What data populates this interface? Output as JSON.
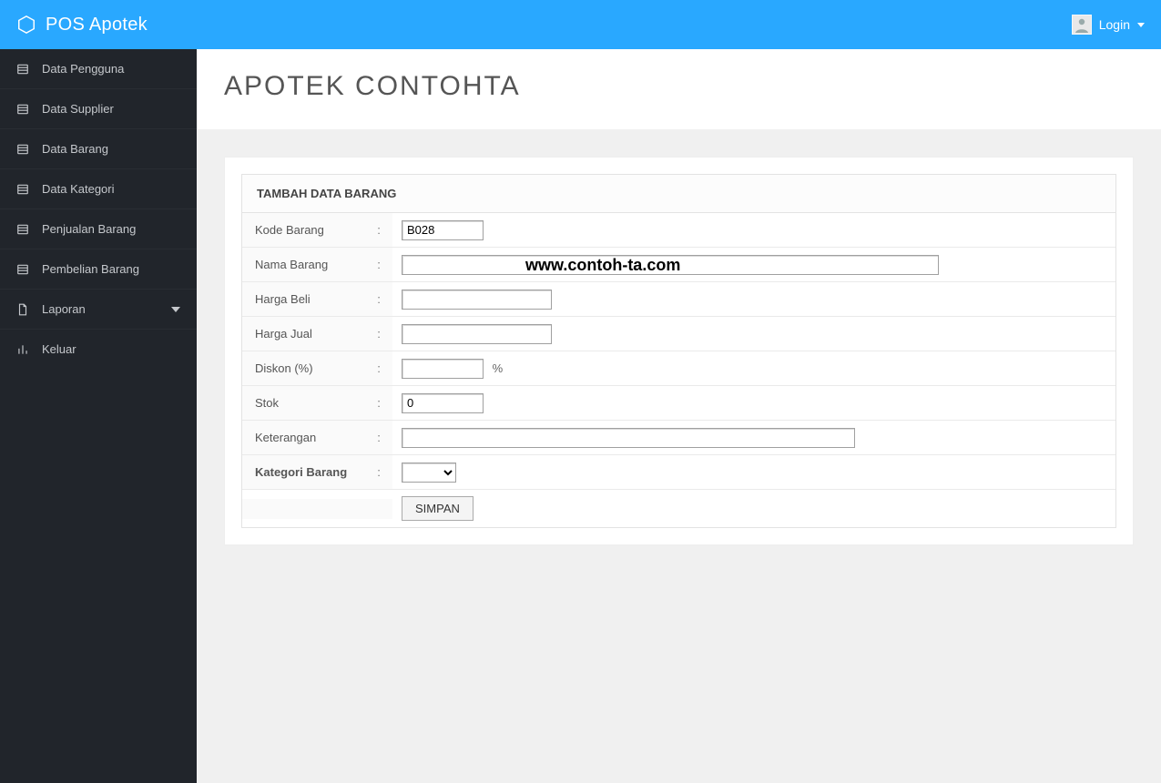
{
  "topbar": {
    "brand": "POS Apotek",
    "login_label": "Login"
  },
  "sidebar": {
    "items": [
      {
        "label": "Data Pengguna"
      },
      {
        "label": "Data Supplier"
      },
      {
        "label": "Data Barang"
      },
      {
        "label": "Data Kategori"
      },
      {
        "label": "Penjualan Barang"
      },
      {
        "label": "Pembelian Barang"
      },
      {
        "label": "Laporan"
      },
      {
        "label": "Keluar"
      }
    ]
  },
  "page": {
    "title": "APOTEK CONTOHTA"
  },
  "form": {
    "title": "TAMBAH DATA BARANG",
    "rows": {
      "kode": {
        "label": "Kode Barang",
        "value": "B028"
      },
      "nama": {
        "label": "Nama Barang",
        "value": ""
      },
      "harga_beli": {
        "label": "Harga Beli",
        "value": ""
      },
      "harga_jual": {
        "label": "Harga Jual",
        "value": ""
      },
      "diskon": {
        "label": "Diskon (%)",
        "value": "",
        "suffix": "%"
      },
      "stok": {
        "label": "Stok",
        "value": "0"
      },
      "keterangan": {
        "label": "Keterangan",
        "value": ""
      },
      "kategori": {
        "label": "Kategori Barang",
        "selected": ""
      }
    },
    "submit_label": "SIMPAN"
  },
  "watermark": "www.contoh-ta.com"
}
